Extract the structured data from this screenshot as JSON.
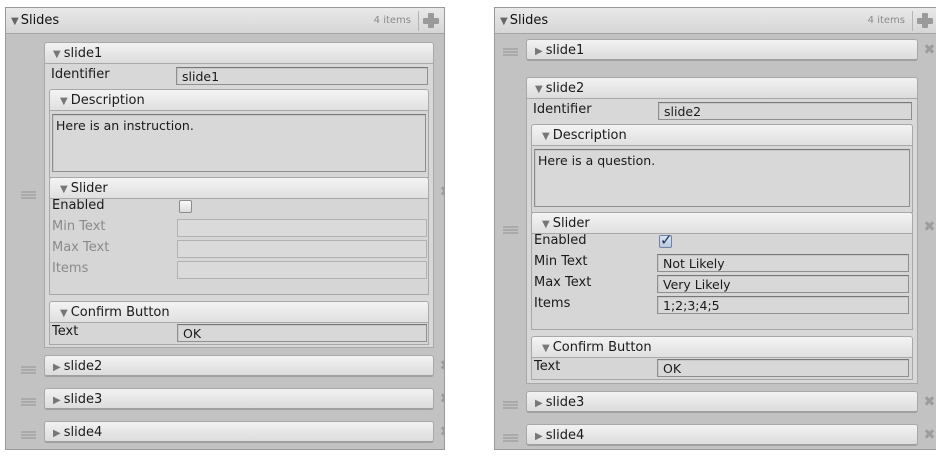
{
  "left": {
    "title": "Slides",
    "count": "4 items",
    "slide1": {
      "header": "slide1",
      "identifier_label": "Identifier",
      "identifier_value": "slide1",
      "description": {
        "header": "Description",
        "value": "Here is an instruction."
      },
      "slider": {
        "header": "Slider",
        "enabled_label": "Enabled",
        "enabled": false,
        "min_label": "Min Text",
        "min_value": "",
        "max_label": "Max Text",
        "max_value": "",
        "items_label": "Items",
        "items_value": ""
      },
      "confirm": {
        "header": "Confirm Button",
        "text_label": "Text",
        "text_value": "OK"
      }
    },
    "collapsed": [
      "slide2",
      "slide3",
      "slide4"
    ]
  },
  "right": {
    "title": "Slides",
    "count": "4 items",
    "slide1": "slide1",
    "slide2": {
      "header": "slide2",
      "identifier_label": "Identifier",
      "identifier_value": "slide2",
      "description": {
        "header": "Description",
        "value": "Here is a question."
      },
      "slider": {
        "header": "Slider",
        "enabled_label": "Enabled",
        "enabled": true,
        "min_label": "Min Text",
        "min_value": "Not Likely",
        "max_label": "Max Text",
        "max_value": "Very Likely",
        "items_label": "Items",
        "items_value": "1;2;3;4;5"
      },
      "confirm": {
        "header": "Confirm Button",
        "text_label": "Text",
        "text_value": "OK"
      }
    },
    "collapsed": [
      "slide3",
      "slide4"
    ]
  },
  "icons": {
    "expanded": "triangle-down-icon",
    "collapsed": "triangle-right-icon",
    "add": "plus-icon",
    "remove": "close-icon",
    "drag": "grip-icon"
  }
}
